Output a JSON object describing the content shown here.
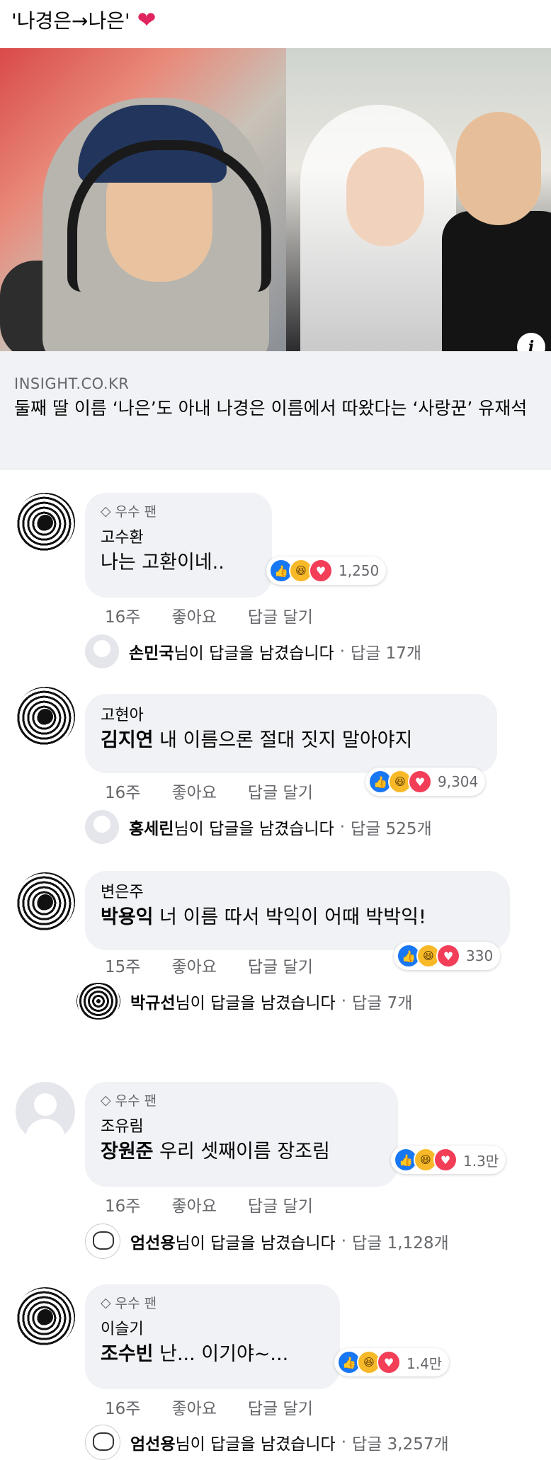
{
  "post": {
    "title": "'나경은→나은'",
    "heart": "❤️"
  },
  "link_card": {
    "domain": "INSIGHT.CO.KR",
    "title": "둘째 딸 이름 ‘나은’도 아내 나경은 이름에서 따왔다는 ‘사랑꾼’ 유재석",
    "info_icon": "i"
  },
  "labels": {
    "fan_badge": "우수 팬",
    "like": "좋아요",
    "reply": "답글 달기",
    "reply_suffix": "님이 답글을 남겼습니다",
    "dot": "·"
  },
  "comments": [
    {
      "fan": true,
      "name": "고수환",
      "mention": "",
      "text": "나는 고환이네..",
      "reactions": "1,250",
      "time": "16주",
      "reply_user": "손민국",
      "reply_count": "답글 17개"
    },
    {
      "fan": false,
      "name": "고현아",
      "mention": "김지연",
      "text": " 내 이름으론 절대 짓지 말아야지",
      "reactions": "9,304",
      "time": "16주",
      "reply_user": "홍세린",
      "reply_count": "답글 525개"
    },
    {
      "fan": false,
      "name": "변은주",
      "mention": "박용익",
      "text": " 너 이름 따서 박익이 어때 박박익!",
      "reactions": "330",
      "time": "15주",
      "reply_user": "박규선",
      "reply_count": "답글 7개"
    },
    {
      "fan": true,
      "name": "조유림",
      "mention": "장원준",
      "text": " 우리 셋째이름 장조림",
      "reactions": "1.3만",
      "time": "16주",
      "reply_user": "엄선용",
      "reply_count": "답글 1,128개"
    },
    {
      "fan": true,
      "name": "이슬기",
      "mention": "조수빈",
      "text": " 난... 이기야~...",
      "reactions": "1.4만",
      "time": "16주",
      "reply_user": "엄선용",
      "reply_count": "답글 3,257개"
    }
  ],
  "icons": {
    "diamond": "diamond-icon",
    "like": "like-reaction-icon",
    "haha": "haha-reaction-icon",
    "love": "love-reaction-icon"
  },
  "colors": {
    "link_blue": "#1877f2",
    "bubble_bg": "#f0f2f5",
    "muted_text": "#65676b",
    "heart_red": "#e0245e"
  }
}
